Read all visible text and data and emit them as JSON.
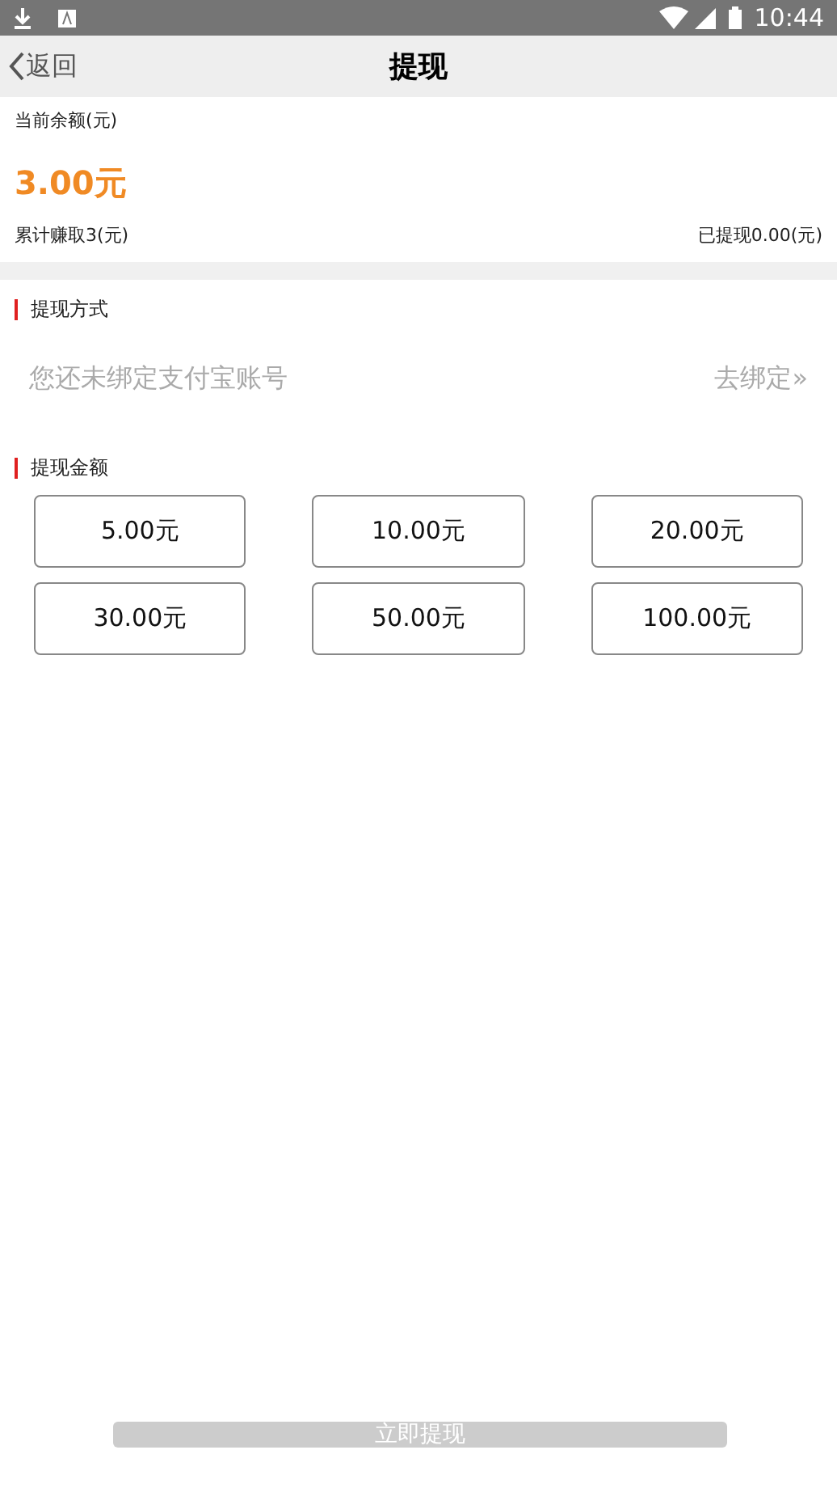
{
  "status_bar": {
    "time": "10:44"
  },
  "header": {
    "back": "返回",
    "title": "提现"
  },
  "balance": {
    "label": "当前余额(元)",
    "amount": "3.00元",
    "earned": "累计赚取3(元)",
    "withdrawn": "已提现0.00(元)"
  },
  "method": {
    "heading": "提现方式",
    "message": "您还未绑定支付宝账号",
    "link": "去绑定»"
  },
  "amounts": {
    "heading": "提现金额",
    "options": [
      {
        "label": "5.00元",
        "selected": false
      },
      {
        "label": "10.00元",
        "selected": false
      },
      {
        "label": "20.00元",
        "selected": false
      },
      {
        "label": "30.00元",
        "selected": false
      },
      {
        "label": "50.00元",
        "selected": false
      },
      {
        "label": "100.00元",
        "selected": false
      }
    ]
  },
  "submit": {
    "label": "立即提现",
    "disabled": true
  }
}
